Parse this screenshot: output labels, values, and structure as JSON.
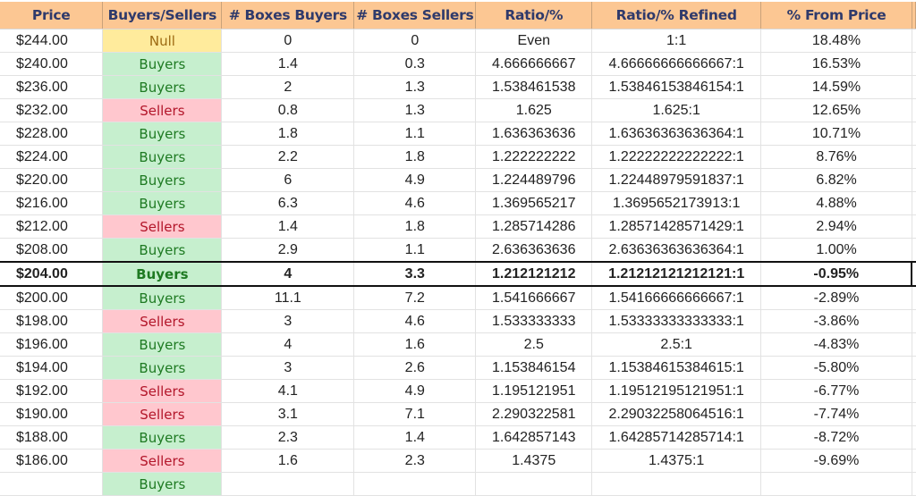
{
  "headers": [
    "Price",
    "Buyers/Sellers",
    "# Boxes Buyers",
    "# Boxes Sellers",
    "Ratio/%",
    "Ratio/% Refined",
    "% From Price"
  ],
  "colors": {
    "header_bg": "#fcc793",
    "header_text": "#2f3a6b",
    "buyers_bg": "#c6efce",
    "buyers_text": "#1e7a22",
    "sellers_bg": "#ffc7ce",
    "sellers_text": "#b3162a",
    "null_bg": "#ffeb9c",
    "null_text": "#9c6a12"
  },
  "current_price_row": 10,
  "rows": [
    {
      "price": "$244.00",
      "side": "Null",
      "buyers": "0",
      "sellers": "0",
      "ratio": "Even",
      "refined": "1:1",
      "pct": "18.48%"
    },
    {
      "price": "$240.00",
      "side": "Buyers",
      "buyers": "1.4",
      "sellers": "0.3",
      "ratio": "4.666666667",
      "refined": "4.66666666666667:1",
      "pct": "16.53%"
    },
    {
      "price": "$236.00",
      "side": "Buyers",
      "buyers": "2",
      "sellers": "1.3",
      "ratio": "1.538461538",
      "refined": "1.53846153846154:1",
      "pct": "14.59%"
    },
    {
      "price": "$232.00",
      "side": "Sellers",
      "buyers": "0.8",
      "sellers": "1.3",
      "ratio": "1.625",
      "refined": "1.625:1",
      "pct": "12.65%"
    },
    {
      "price": "$228.00",
      "side": "Buyers",
      "buyers": "1.8",
      "sellers": "1.1",
      "ratio": "1.636363636",
      "refined": "1.63636363636364:1",
      "pct": "10.71%"
    },
    {
      "price": "$224.00",
      "side": "Buyers",
      "buyers": "2.2",
      "sellers": "1.8",
      "ratio": "1.222222222",
      "refined": "1.22222222222222:1",
      "pct": "8.76%"
    },
    {
      "price": "$220.00",
      "side": "Buyers",
      "buyers": "6",
      "sellers": "4.9",
      "ratio": "1.224489796",
      "refined": "1.22448979591837:1",
      "pct": "6.82%"
    },
    {
      "price": "$216.00",
      "side": "Buyers",
      "buyers": "6.3",
      "sellers": "4.6",
      "ratio": "1.369565217",
      "refined": "1.3695652173913:1",
      "pct": "4.88%"
    },
    {
      "price": "$212.00",
      "side": "Sellers",
      "buyers": "1.4",
      "sellers": "1.8",
      "ratio": "1.285714286",
      "refined": "1.28571428571429:1",
      "pct": "2.94%"
    },
    {
      "price": "$208.00",
      "side": "Buyers",
      "buyers": "2.9",
      "sellers": "1.1",
      "ratio": "2.636363636",
      "refined": "2.63636363636364:1",
      "pct": "1.00%"
    },
    {
      "price": "$204.00",
      "side": "Buyers",
      "buyers": "4",
      "sellers": "3.3",
      "ratio": "1.212121212",
      "refined": "1.21212121212121:1",
      "pct": "-0.95%"
    },
    {
      "price": "$200.00",
      "side": "Buyers",
      "buyers": "11.1",
      "sellers": "7.2",
      "ratio": "1.541666667",
      "refined": "1.54166666666667:1",
      "pct": "-2.89%"
    },
    {
      "price": "$198.00",
      "side": "Sellers",
      "buyers": "3",
      "sellers": "4.6",
      "ratio": "1.533333333",
      "refined": "1.53333333333333:1",
      "pct": "-3.86%"
    },
    {
      "price": "$196.00",
      "side": "Buyers",
      "buyers": "4",
      "sellers": "1.6",
      "ratio": "2.5",
      "refined": "2.5:1",
      "pct": "-4.83%"
    },
    {
      "price": "$194.00",
      "side": "Buyers",
      "buyers": "3",
      "sellers": "2.6",
      "ratio": "1.153846154",
      "refined": "1.15384615384615:1",
      "pct": "-5.80%"
    },
    {
      "price": "$192.00",
      "side": "Sellers",
      "buyers": "4.1",
      "sellers": "4.9",
      "ratio": "1.195121951",
      "refined": "1.19512195121951:1",
      "pct": "-6.77%"
    },
    {
      "price": "$190.00",
      "side": "Sellers",
      "buyers": "3.1",
      "sellers": "7.1",
      "ratio": "2.290322581",
      "refined": "2.29032258064516:1",
      "pct": "-7.74%"
    },
    {
      "price": "$188.00",
      "side": "Buyers",
      "buyers": "2.3",
      "sellers": "1.4",
      "ratio": "1.642857143",
      "refined": "1.64285714285714:1",
      "pct": "-8.72%"
    },
    {
      "price": "$186.00",
      "side": "Sellers",
      "buyers": "1.6",
      "sellers": "2.3",
      "ratio": "1.4375",
      "refined": "1.4375:1",
      "pct": "-9.69%"
    },
    {
      "price": "",
      "side": "Buyers",
      "buyers": "",
      "sellers": "",
      "ratio": "",
      "refined": "",
      "pct": ""
    }
  ]
}
